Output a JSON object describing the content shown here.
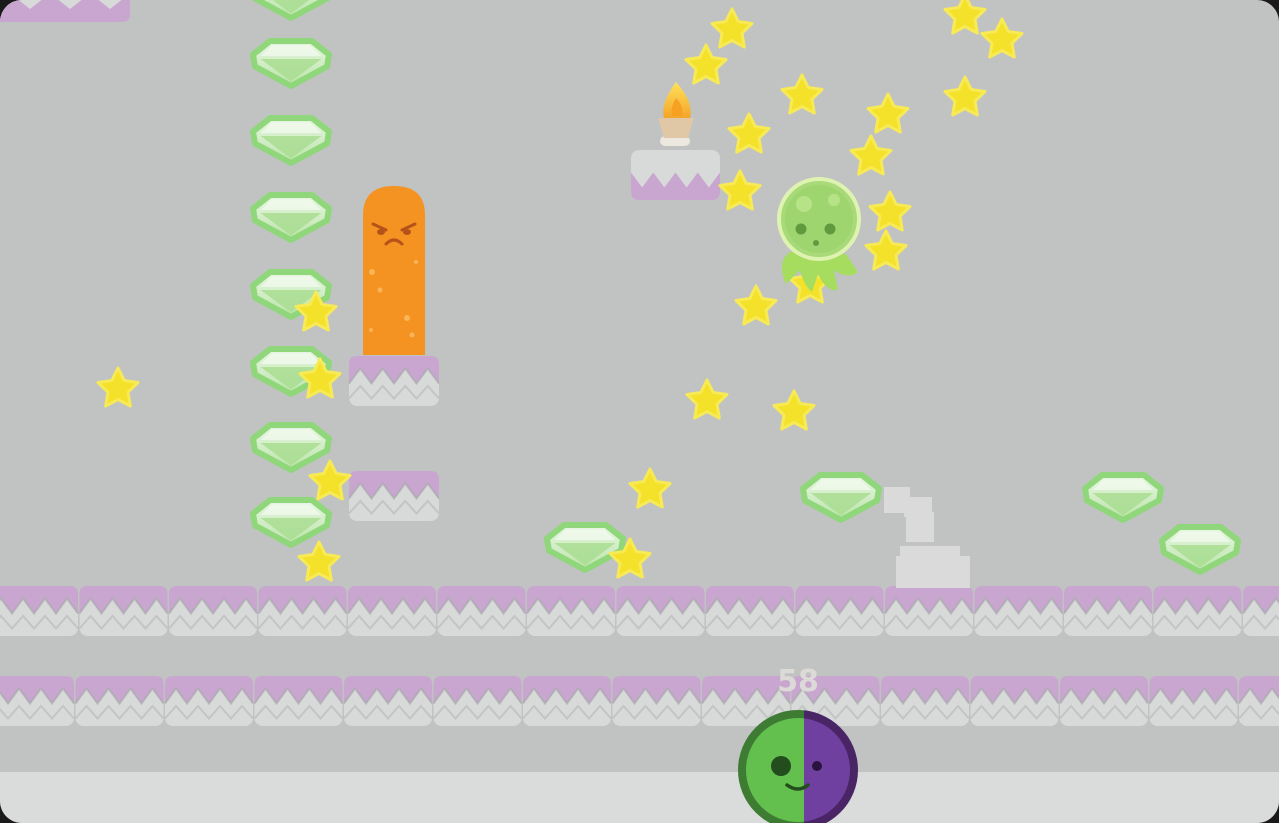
{
  "hud": {
    "score_value": "58",
    "player_toggle_icon": "green-purple-face-button-icon"
  },
  "colors": {
    "background": "#c1c3c2",
    "platform_top": "#c8a6d0",
    "platform_bottom": "#d8d9d9",
    "gem_fill": "#cfe9c6",
    "gem_outline": "#8fd77a",
    "star": "#f4e12a",
    "lava_monster": "#f49322",
    "player_green": "#5fbf4f",
    "player_purple": "#6a3c8f"
  },
  "entities": {
    "player_icon": "green-alien-in-bubble-icon",
    "enemy_icon": "angry-orange-lava-pillar-icon",
    "torch_icon": "flame-torch-icon",
    "ghost_icon": "faded-ghost-silhouette-icon"
  }
}
